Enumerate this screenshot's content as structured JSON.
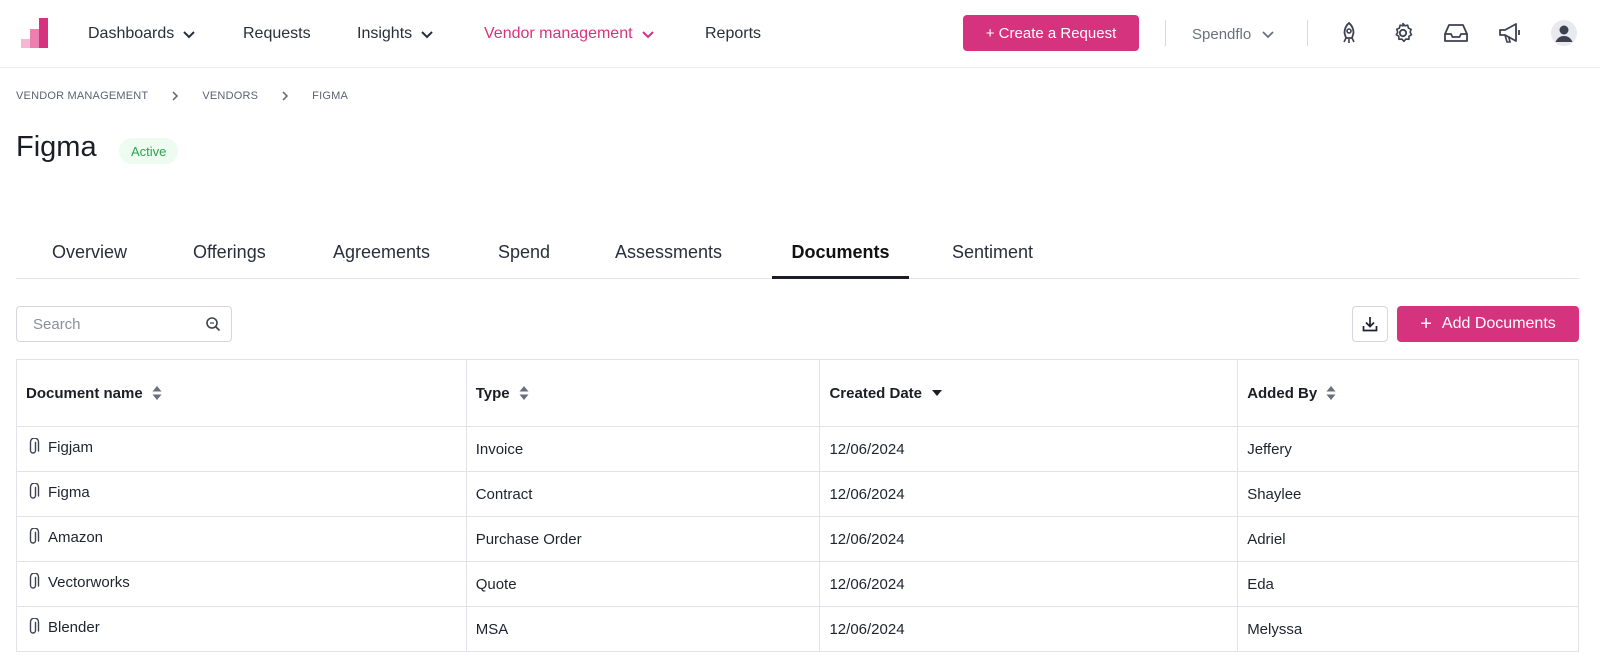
{
  "nav": {
    "items": [
      {
        "label": "Dashboards",
        "has_dropdown": true,
        "active": false
      },
      {
        "label": "Requests",
        "has_dropdown": false,
        "active": false
      },
      {
        "label": "Insights",
        "has_dropdown": true,
        "active": false
      },
      {
        "label": "Vendor management",
        "has_dropdown": true,
        "active": true
      },
      {
        "label": "Reports",
        "has_dropdown": false,
        "active": false
      }
    ],
    "create_button": "+ Create a Request",
    "org_name": "Spendflo",
    "icons": [
      "rocket-icon",
      "gear-icon",
      "inbox-icon",
      "megaphone-icon",
      "user-avatar-icon"
    ]
  },
  "breadcrumb": [
    "VENDOR MANAGEMENT",
    "VENDORS",
    "FIGMA"
  ],
  "page": {
    "title": "Figma",
    "status": "Active"
  },
  "tabs": [
    {
      "label": "Overview",
      "active": false
    },
    {
      "label": "Offerings",
      "active": false
    },
    {
      "label": "Agreements",
      "active": false
    },
    {
      "label": "Spend",
      "active": false
    },
    {
      "label": "Assessments",
      "active": false
    },
    {
      "label": "Documents",
      "active": true
    },
    {
      "label": "Sentiment",
      "active": false
    }
  ],
  "toolbar": {
    "search_placeholder": "Search",
    "add_button": "Add Documents"
  },
  "table": {
    "columns": [
      {
        "label": "Document name",
        "sort": "both"
      },
      {
        "label": "Type",
        "sort": "both"
      },
      {
        "label": "Created Date",
        "sort": "desc"
      },
      {
        "label": "Added By",
        "sort": "both"
      }
    ],
    "rows": [
      {
        "name": "Figjam",
        "type": "Invoice",
        "date": "12/06/2024",
        "added_by": "Jeffery"
      },
      {
        "name": "Figma",
        "type": "Contract",
        "date": "12/06/2024",
        "added_by": "Shaylee"
      },
      {
        "name": "Amazon",
        "type": "Purchase Order",
        "date": "12/06/2024",
        "added_by": "Adriel"
      },
      {
        "name": "Vectorworks",
        "type": "Quote",
        "date": "12/06/2024",
        "added_by": "Eda"
      },
      {
        "name": "Blender",
        "type": "MSA",
        "date": "12/06/2024",
        "added_by": "Melyssa"
      }
    ]
  },
  "colors": {
    "brand": "#d6337f",
    "status_active_bg": "#eefbf1",
    "status_active_text": "#2fa24d"
  }
}
